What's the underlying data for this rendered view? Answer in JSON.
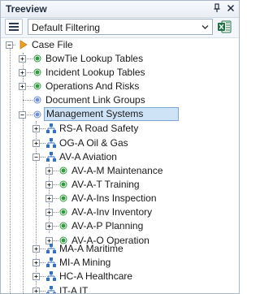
{
  "window": {
    "title": "Treeview"
  },
  "toolbar": {
    "filter_value": "Default Filtering"
  },
  "tree": {
    "root": {
      "label": "Case File"
    },
    "items": [
      {
        "label": "BowTie Lookup Tables",
        "icon": "green-dot-icon"
      },
      {
        "label": "Incident Lookup Tables",
        "icon": "green-dot-icon"
      },
      {
        "label": "Operations And Risks",
        "icon": "green-dot-icon"
      },
      {
        "label": "Document Link Groups",
        "icon": "blue-dot-icon"
      },
      {
        "label": "Management Systems",
        "icon": "blue-dot-icon"
      },
      {
        "label": "RS-A Road Safety"
      },
      {
        "label": "OG-A Oil & Gas"
      },
      {
        "label": "AV-A Aviation"
      },
      {
        "label": "AV-A-M Maintenance"
      },
      {
        "label": "AV-A-T Training"
      },
      {
        "label": "AV-A-Ins Inspection"
      },
      {
        "label": "AV-A-Inv Inventory"
      },
      {
        "label": "AV-A-P Planning"
      },
      {
        "label": "AV-A-O Operation"
      },
      {
        "label": "MA-A Maritime"
      },
      {
        "label": "MI-A Mining"
      },
      {
        "label": "HC-A Healthcare"
      },
      {
        "label": "IT-A IT"
      }
    ]
  },
  "colors": {
    "selection_bg": "#cfe3f7",
    "selection_border": "#7fa7d4",
    "green_dot": "#2e9a3c",
    "blue_dot": "#6f8fd6",
    "hierarchy_blue": "#2f6fd0",
    "case_orange": "#f0a020"
  }
}
